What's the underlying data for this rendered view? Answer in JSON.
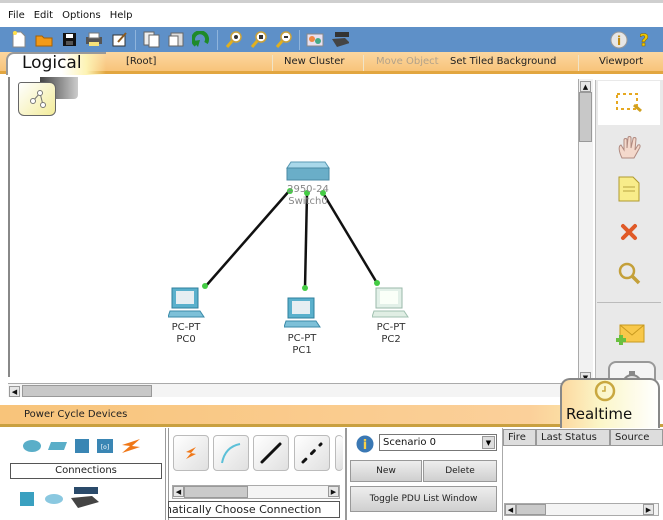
{
  "menu": [
    "File",
    "Edit",
    "Options",
    "Help"
  ],
  "toolbar": {
    "icons": [
      "new-file-icon",
      "open-folder-icon",
      "save-icon",
      "print-icon",
      "activity-wizard-icon",
      "copy-icon",
      "paste-icon",
      "undo-icon",
      "zoom-in-icon",
      "zoom-reset-icon",
      "zoom-out-icon",
      "palette-icon",
      "custom-device-icon"
    ],
    "right_icons": [
      "info-icon",
      "help-icon"
    ]
  },
  "logical_bar": {
    "tab_label": "Logical",
    "root": "[Root]",
    "new_cluster": "New Cluster",
    "move_object": "Move Object",
    "set_tiled_background": "Set Tiled Background",
    "viewport": "Viewport"
  },
  "topology": {
    "switch": {
      "model": "2950-24",
      "name": "Switch0"
    },
    "pcs": [
      {
        "model": "PC-PT",
        "name": "PC0"
      },
      {
        "model": "PC-PT",
        "name": "PC1"
      },
      {
        "model": "PC-PT",
        "name": "PC2"
      }
    ],
    "link_color": "#111111",
    "port_color": "#44cc44"
  },
  "right_tools": [
    "select-icon",
    "move-layout-icon",
    "place-note-icon",
    "delete-icon",
    "inspect-icon",
    "add-simple-pdu-icon",
    "add-complex-pdu-icon"
  ],
  "bottom": {
    "power_cycle": "Power Cycle Devices",
    "realtime_label": "Realtime",
    "device_category_label": "Connections",
    "connection_name": "Automatically Choose Connection Type",
    "connection_name_visible": "natically Choose Connection",
    "scenario": {
      "selected": "Scenario 0",
      "new": "New",
      "delete": "Delete",
      "toggle": "Toggle PDU List Window"
    },
    "pdu_columns": [
      "Fire",
      "Last Status",
      "Source"
    ]
  }
}
